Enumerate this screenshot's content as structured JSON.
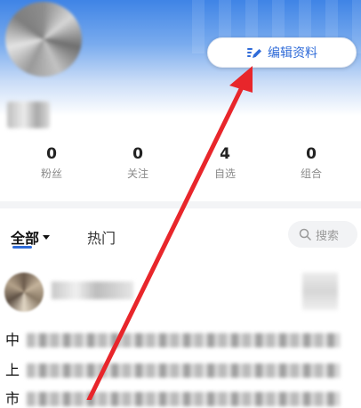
{
  "profile": {
    "edit_profile_label": "编辑资料"
  },
  "stats": [
    {
      "value": "0",
      "label": "粉丝"
    },
    {
      "value": "0",
      "label": "关注"
    },
    {
      "value": "4",
      "label": "自选"
    },
    {
      "value": "0",
      "label": "组合"
    }
  ],
  "tabs": {
    "all_label": "全部",
    "hot_label": "热门"
  },
  "search": {
    "placeholder": "搜索"
  },
  "post": {
    "line_starts": [
      "中",
      "上",
      "市"
    ]
  },
  "colors": {
    "accent": "#2f6bd8",
    "header_top": "#3f84e6",
    "annotation_arrow": "#e8262b"
  },
  "icons": {
    "edit": "pencil-edit-icon",
    "dropdown": "caret-down-icon",
    "search": "search-icon"
  }
}
